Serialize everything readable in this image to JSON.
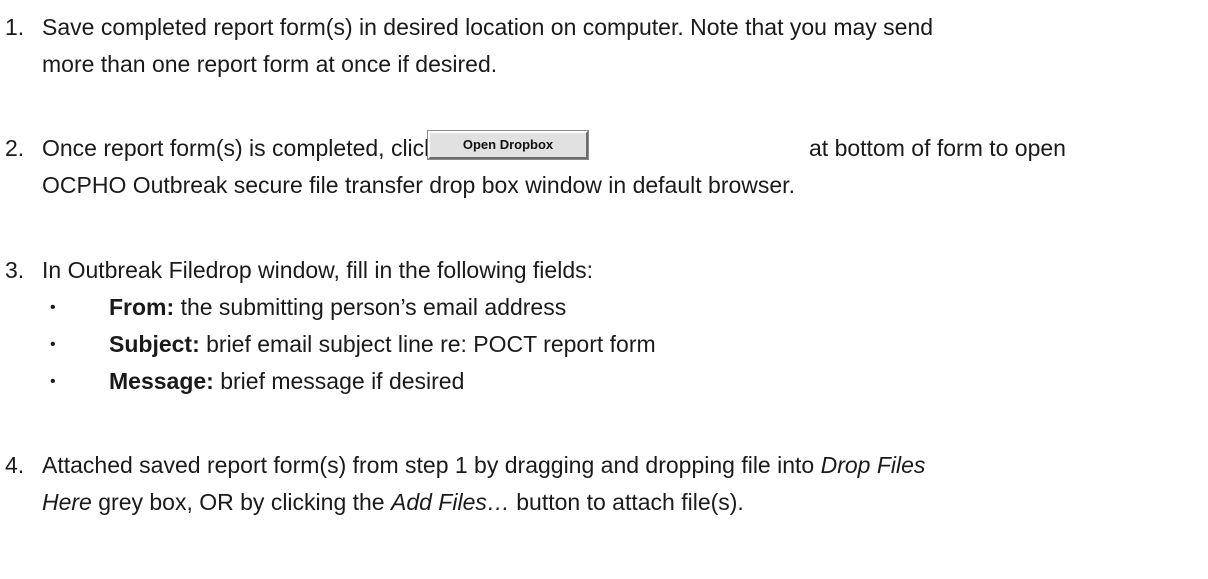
{
  "steps": [
    {
      "number": "1.",
      "line1": "Save completed report form(s) in desired location on computer. Note that you may send",
      "line2": "more than one report form at once if desired."
    },
    {
      "number": "2.",
      "line1_before": "Once report form(s) is completed, click",
      "button_label": "Open Dropbox",
      "line1_after": "at bottom of form to open",
      "line2": "OCPHO Outbreak secure file transfer drop box window in default browser."
    },
    {
      "number": "3.",
      "line1": "In Outbreak Filedrop window, fill in the following fields:",
      "bullets": [
        {
          "label": "From:",
          "text": "the submitting person’s email address"
        },
        {
          "label": "Subject:",
          "text": "brief email subject line re: POCT report form"
        },
        {
          "label": "Message:",
          "text": "brief message if desired"
        }
      ]
    },
    {
      "number": "4.",
      "line1_before": "Attached saved report form(s) from step 1 by dragging and dropping file into",
      "line1_italic": "Drop Files",
      "line2_italic": "Here",
      "line2_mid": "grey box, OR by clicking the",
      "line2_italic2": "Add Files…",
      "line2_after": "button to attach file(s)."
    }
  ],
  "bullet_glyph": "•"
}
